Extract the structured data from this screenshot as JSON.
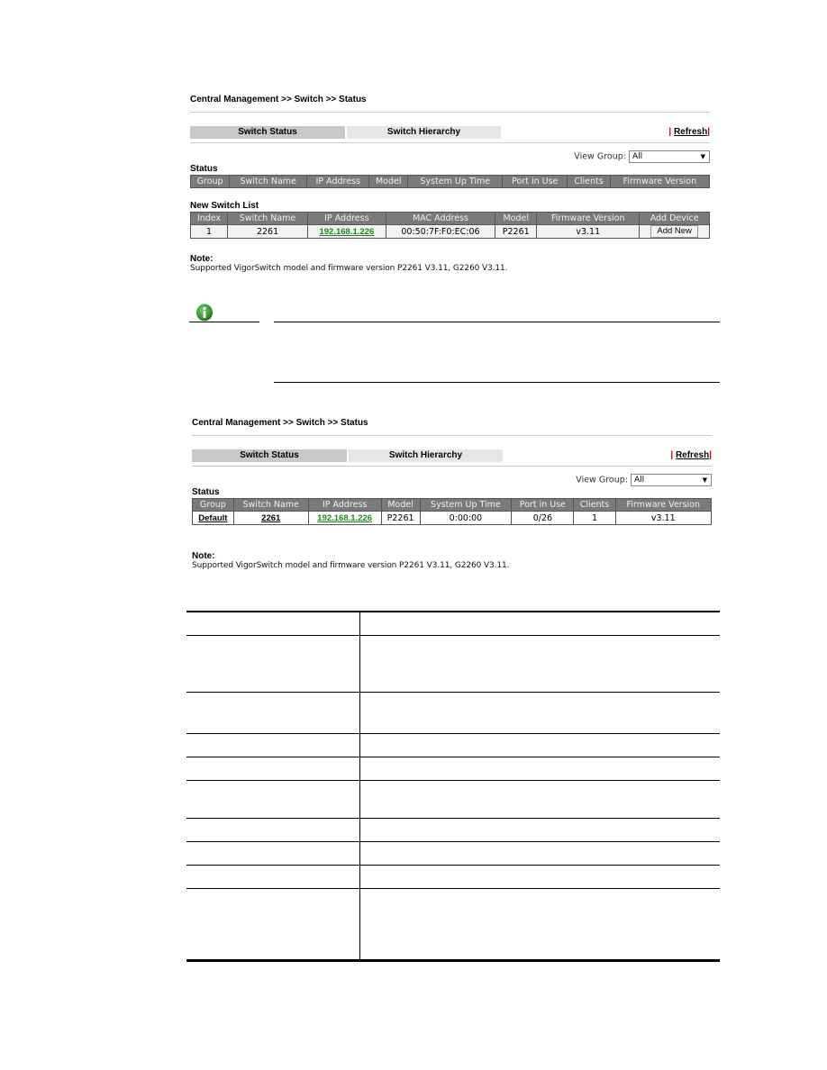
{
  "screens": [
    {
      "breadcrumb": "Central Management >> Switch >> Status",
      "tabs": [
        {
          "label": "Switch Status",
          "active": true
        },
        {
          "label": "Switch Hierarchy",
          "active": false
        }
      ],
      "refresh_label": "Refresh",
      "view_group": {
        "label": "View Group:",
        "selected": "All"
      },
      "status": {
        "title": "Status",
        "columns": [
          "Group",
          "Switch Name",
          "IP Address",
          "Model",
          "System Up Time",
          "Port in Use",
          "Clients",
          "Firmware Version"
        ],
        "rows": []
      },
      "new_switch_list": {
        "title": "New Switch List",
        "columns": [
          "Index",
          "Switch Name",
          "IP Address",
          "MAC Address",
          "Model",
          "Firmware Version",
          "Add Device"
        ],
        "rows": [
          {
            "index": "1",
            "switch_name": "2261",
            "ip": "192.168.1.226",
            "mac": "00:50:7F:F0:EC:06",
            "model": "P2261",
            "firmware": "v3.11",
            "action": "Add New"
          }
        ]
      },
      "note": {
        "title": "Note:",
        "text": "Supported VigorSwitch model and firmware version P2261 V3.11, G2260 V3.11."
      }
    },
    {
      "breadcrumb": "Central Management >> Switch >> Status",
      "tabs": [
        {
          "label": "Switch Status",
          "active": true
        },
        {
          "label": "Switch Hierarchy",
          "active": false
        }
      ],
      "refresh_label": "Refresh",
      "view_group": {
        "label": "View Group:",
        "selected": "All"
      },
      "status": {
        "title": "Status",
        "columns": [
          "Group",
          "Switch Name",
          "IP Address",
          "Model",
          "System Up Time",
          "Port in Use",
          "Clients",
          "Firmware Version"
        ],
        "rows": [
          {
            "group": "Default",
            "switch_name": "2261",
            "ip": "192.168.1.226",
            "model": "P2261",
            "uptime": "0:00:00",
            "ports": "0/26",
            "clients": "1",
            "firmware": "v3.11"
          }
        ]
      },
      "note": {
        "title": "Note:",
        "text": "Supported VigorSwitch model and firmware version P2261 V3.11, G2260 V3.11."
      }
    }
  ],
  "info_box": {
    "icon": "info-icon"
  }
}
